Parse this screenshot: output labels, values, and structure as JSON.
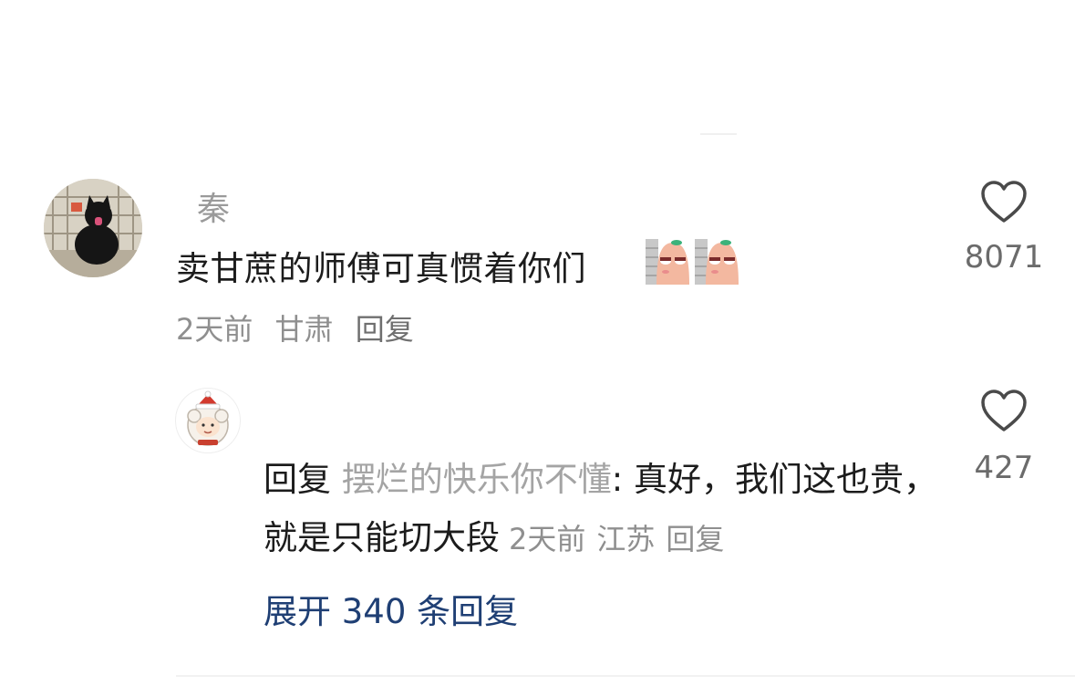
{
  "comment": {
    "username": "秦",
    "text": "卖甘蔗的师傅可真惯着你们",
    "meta": {
      "time": "2天前",
      "location": "甘肃",
      "reply_label": "回复"
    },
    "likes": "8071"
  },
  "reply": {
    "prefix": "回复",
    "target": "摆烂的快乐你不懂",
    "text": ": 真好，我们这也贵，就是只能切大段",
    "meta": {
      "time": "2天前",
      "location": "江苏",
      "reply_label": "回复"
    },
    "likes": "427"
  },
  "expand": {
    "label": "展开 340 条回复"
  },
  "icons": {
    "like": "heart-outline-icon",
    "sticker": "sweet-potato-peeking-sticker"
  },
  "colors": {
    "link_blue": "#1f3f74",
    "muted": "#8f8f8f",
    "text": "#1c1c1c"
  }
}
